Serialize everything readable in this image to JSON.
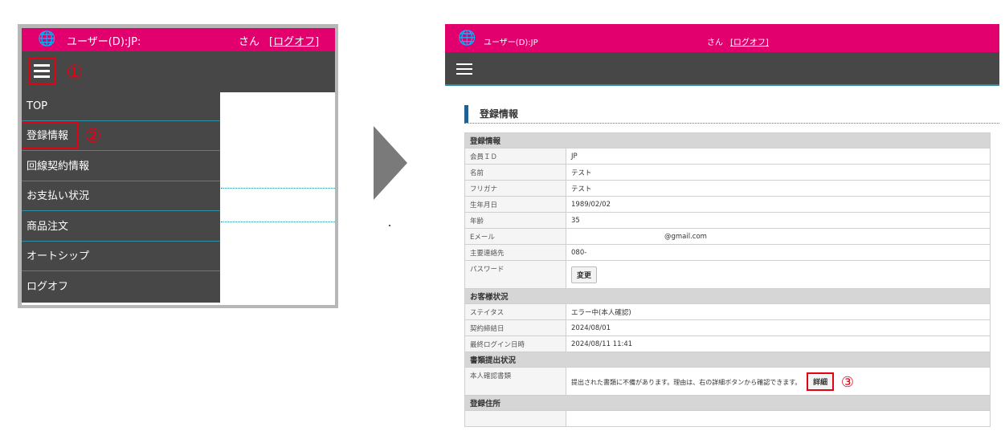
{
  "colors": {
    "header_pink": "#e2006f",
    "nav_dark": "#474747",
    "highlight_red": "#e60012",
    "accent_teal": "#2c8ea0"
  },
  "left": {
    "header": {
      "user": "ユーザー(D):JP:",
      "san": "さん",
      "logout": "[ログオフ]"
    },
    "marker_1": "①",
    "marker_2": "②",
    "menu": [
      "TOP",
      "登録情報",
      "回線契約情報",
      "お支払い状況",
      "商品注文",
      "オートシップ",
      "ログオフ"
    ]
  },
  "right": {
    "header": {
      "user": "ユーザー(D):JP",
      "san": "さん",
      "logout": "[ログオフ]"
    },
    "section_title": "登録情報",
    "groups": {
      "registration": "登録情報",
      "status": "お客様状況",
      "documents": "書類提出状況",
      "address": "登録住所"
    },
    "rows": {
      "member_id": {
        "k": "会員ＩＤ",
        "v": "JP"
      },
      "name": {
        "k": "名前",
        "v": "テスト"
      },
      "furigana": {
        "k": "フリガナ",
        "v": "テスト"
      },
      "birth": {
        "k": "生年月日",
        "v": "1989/02/02"
      },
      "age": {
        "k": "年齢",
        "v": "35"
      },
      "email": {
        "k": "Eメール",
        "v": "@gmail.com"
      },
      "phone": {
        "k": "主要連絡先",
        "v": "080-"
      },
      "password": {
        "k": "パスワード",
        "button": "変更"
      },
      "state": {
        "k": "ステイタス",
        "v": "エラー中(本人確認)"
      },
      "contract_date": {
        "k": "契約締結日",
        "v": "2024/08/01"
      },
      "last_login": {
        "k": "最終ログイン日時",
        "v": "2024/08/11 11:41"
      },
      "id_docs": {
        "k": "本人確認書類",
        "v": "提出された書類に不備があります。理由は、右の詳細ボタンから確認できます。",
        "button": "詳細"
      }
    },
    "marker_3": "③"
  }
}
